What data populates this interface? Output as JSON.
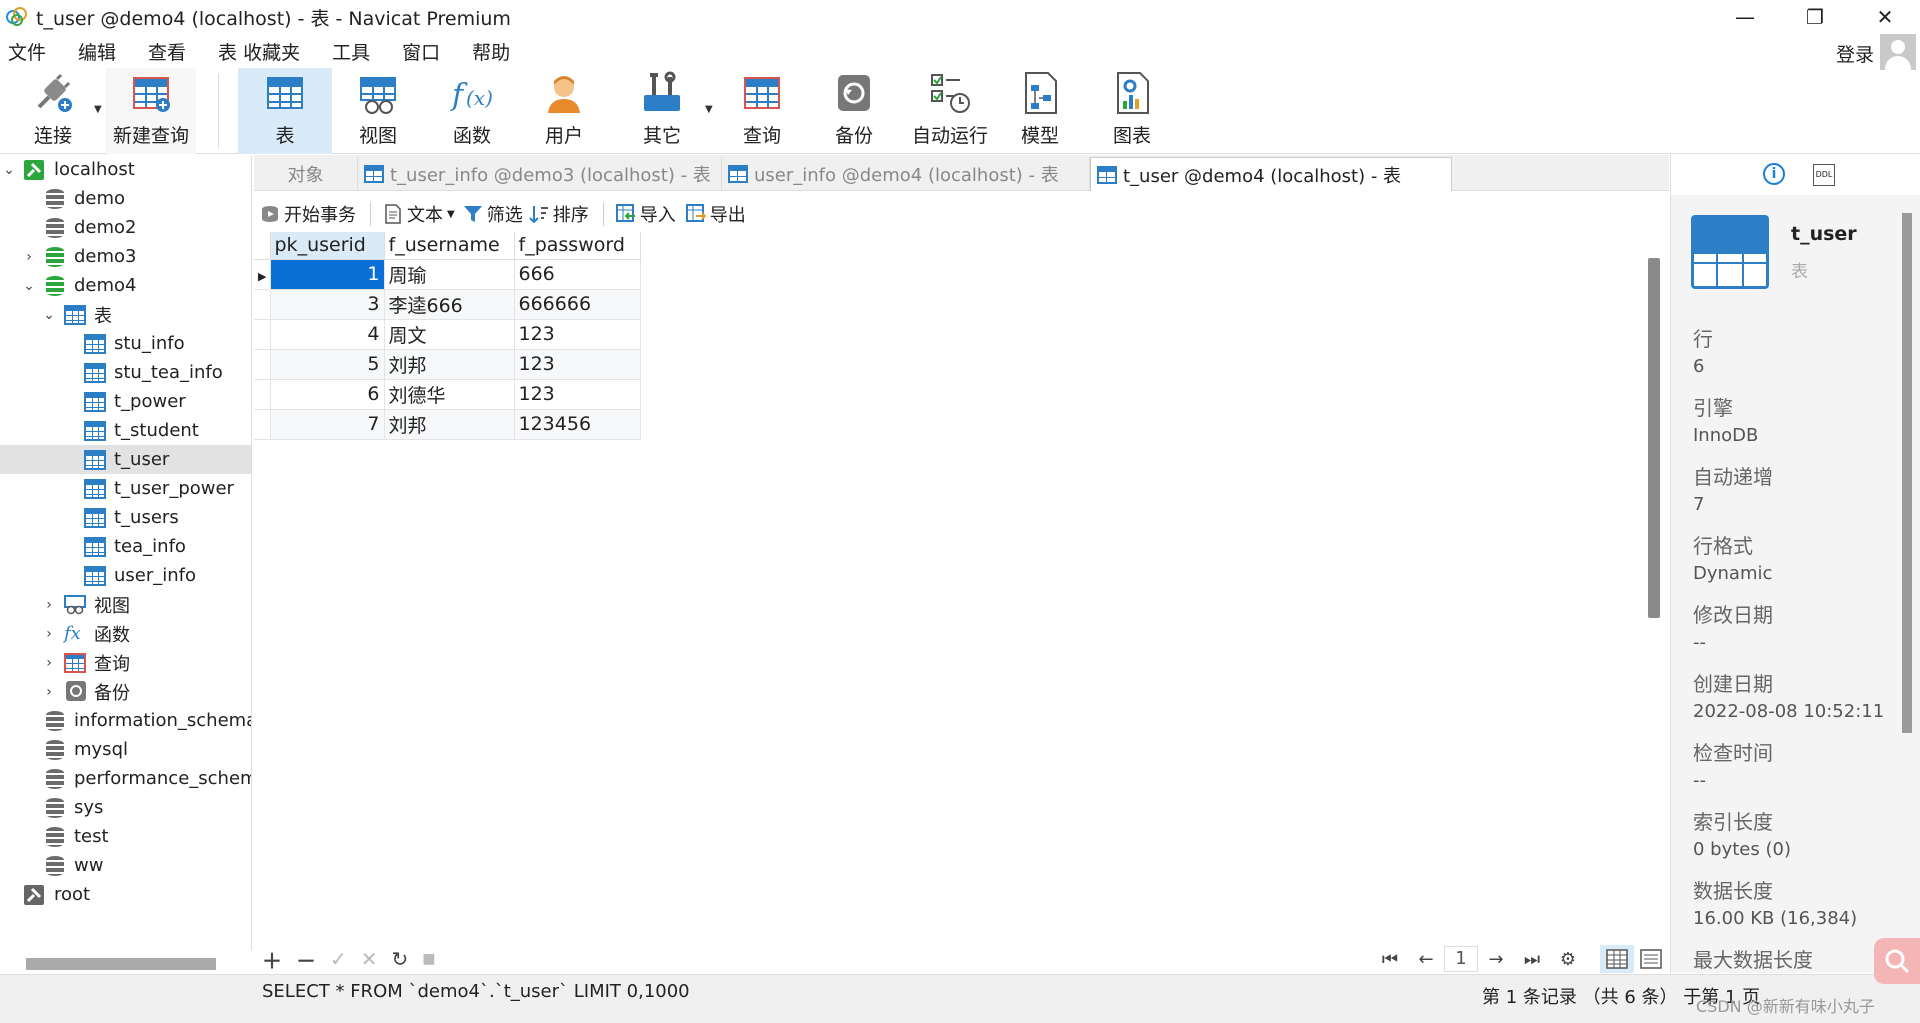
{
  "window": {
    "title": "t_user @demo4 (localhost) - 表 - Navicat Premium",
    "minimize": "—",
    "maximize": "❐",
    "close": "✕"
  },
  "menu": [
    "文件",
    "编辑",
    "查看",
    "表",
    "收藏夹",
    "工具",
    "窗口",
    "帮助"
  ],
  "login_label": "登录",
  "toolbar": {
    "connect": "连接",
    "new_query": "新建查询",
    "table": "表",
    "view": "视图",
    "function": "函数",
    "user": "用户",
    "other": "其它",
    "query": "查询",
    "backup": "备份",
    "auto_run": "自动运行",
    "model": "模型",
    "chart": "图表"
  },
  "tree": {
    "connection": "localhost",
    "databases_top": [
      "demo",
      "demo2",
      "demo3",
      "demo4"
    ],
    "tables_group": "表",
    "tables": [
      "stu_info",
      "stu_tea_info",
      "t_power",
      "t_student",
      "t_user",
      "t_user_power",
      "t_users",
      "tea_info",
      "user_info"
    ],
    "groups": [
      "视图",
      "函数",
      "查询",
      "备份"
    ],
    "databases_bottom": [
      "information_schema",
      "mysql",
      "performance_schema",
      "sys",
      "test",
      "ww"
    ],
    "connection2": "root"
  },
  "tabs": {
    "objects": "对象",
    "tab1": "t_user_info @demo3 (localhost) - 表",
    "tab2": "user_info @demo4 (localhost) - 表",
    "tab3": "t_user @demo4 (localhost) - 表"
  },
  "subtoolbar": {
    "begin_tx": "开始事务",
    "text": "文本",
    "filter": "筛选",
    "sort": "排序",
    "import": "导入",
    "export": "导出"
  },
  "grid": {
    "columns": [
      "pk_userid",
      "f_username",
      "f_password"
    ],
    "rows": [
      [
        "1",
        "周瑜",
        "666"
      ],
      [
        "3",
        "李逵666",
        "666666"
      ],
      [
        "4",
        "周文",
        "123"
      ],
      [
        "5",
        "刘邦",
        "123"
      ],
      [
        "6",
        "刘德华",
        "123"
      ],
      [
        "7",
        "刘邦",
        "123456"
      ]
    ]
  },
  "pager": {
    "page": "1"
  },
  "status": {
    "sql": "SELECT * FROM `demo4`.`t_user` LIMIT 0,1000",
    "record": "第 1 条记录 （共 6 条） 于第 1 页"
  },
  "watermark": "CSDN @新新有味小丸子",
  "info": {
    "name": "t_user",
    "type": "表",
    "fields": [
      {
        "label": "行",
        "value": "6"
      },
      {
        "label": "引擎",
        "value": "InnoDB"
      },
      {
        "label": "自动递增",
        "value": "7"
      },
      {
        "label": "行格式",
        "value": "Dynamic"
      },
      {
        "label": "修改日期",
        "value": "--"
      },
      {
        "label": "创建日期",
        "value": "2022-08-08 10:52:11"
      },
      {
        "label": "检查时间",
        "value": "--"
      },
      {
        "label": "索引长度",
        "value": "0 bytes (0)"
      },
      {
        "label": "数据长度",
        "value": "16.00 KB (16,384)"
      },
      {
        "label": "最大数据长度",
        "value": ""
      }
    ]
  }
}
